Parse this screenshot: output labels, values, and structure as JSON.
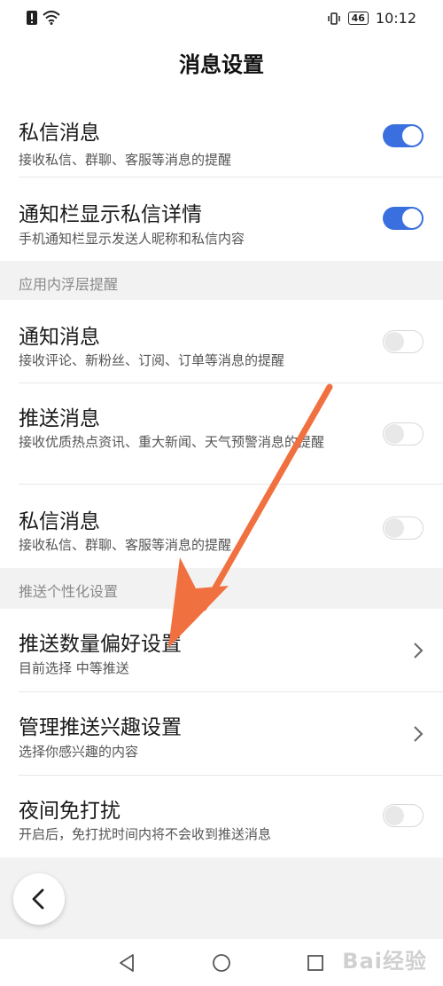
{
  "status_bar": {
    "battery": "46",
    "time": "10:12",
    "icons": [
      "alert-icon",
      "wifi-icon",
      "vibrate-icon",
      "battery-icon"
    ]
  },
  "header": {
    "title": "消息设置"
  },
  "groups": {
    "top": {
      "rows": [
        {
          "title": "私信消息",
          "desc": "接收私信、群聊、客服等消息的提醒",
          "toggle": "on"
        },
        {
          "title": "通知栏显示私信详情",
          "desc": "手机通知栏显示发送人昵称和私信内容",
          "toggle": "on"
        }
      ]
    },
    "in_app": {
      "label": "应用内浮层提醒",
      "rows": [
        {
          "title": "通知消息",
          "desc": "接收评论、新粉丝、订阅、订单等消息的提醒",
          "toggle": "off"
        },
        {
          "title": "推送消息",
          "desc": "接收优质热点资讯、重大新闻、天气预警消息的提醒",
          "toggle": "off"
        },
        {
          "title": "私信消息",
          "desc": "接收私信、群聊、客服等消息的提醒",
          "toggle": "off"
        }
      ]
    },
    "personalized": {
      "label": "推送个性化设置",
      "rows": [
        {
          "title": "推送数量偏好设置",
          "desc": "目前选择 中等推送",
          "control": "chevron"
        },
        {
          "title": "管理推送兴趣设置",
          "desc": "选择你感兴趣的内容",
          "control": "chevron"
        },
        {
          "title": "夜间免打扰",
          "desc": "开启后，免打扰时间内将不会收到推送消息",
          "toggle": "off"
        }
      ]
    }
  },
  "colors": {
    "toggle_on": "#3a6fe0",
    "annotation_arrow": "#f07040"
  },
  "watermark": "Bai经验"
}
